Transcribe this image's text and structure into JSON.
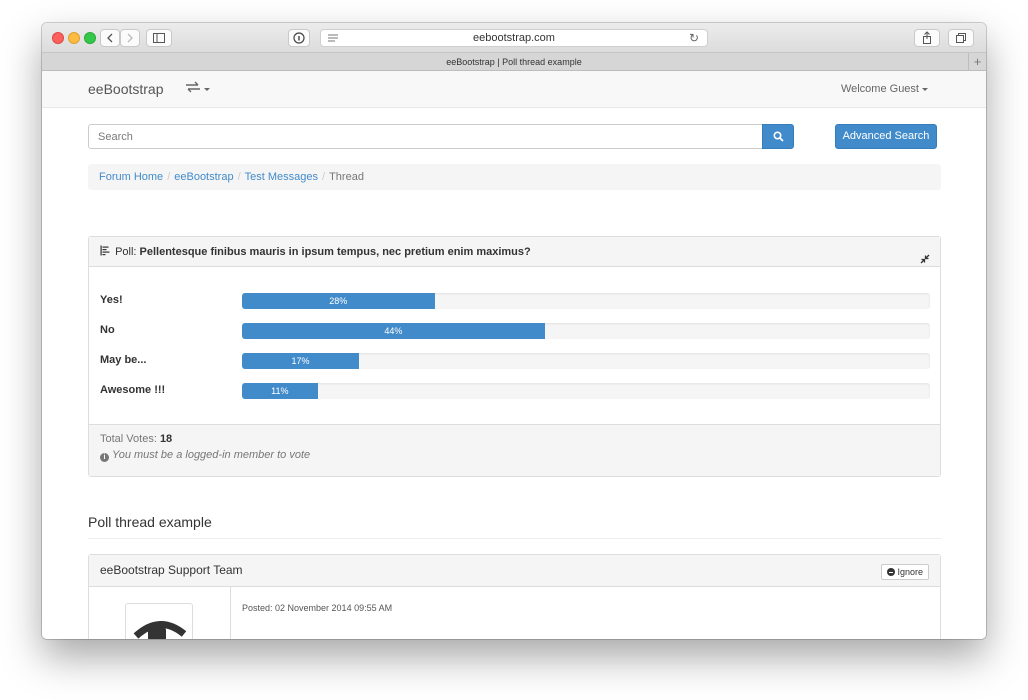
{
  "browser": {
    "url": "eebootstrap.com",
    "tab_title": "eeBootstrap | Poll thread example"
  },
  "navbar": {
    "brand": "eeBootstrap",
    "welcome": "Welcome Guest"
  },
  "search": {
    "placeholder": "Search",
    "advanced_label": "Advanced Search"
  },
  "breadcrumb": {
    "items": [
      "Forum Home",
      "eeBootstrap",
      "Test Messages"
    ],
    "current": "Thread"
  },
  "poll": {
    "prefix": "Poll:",
    "question": "Pellentesque finibus mauris in ipsum tempus, nec pretium enim maximus?",
    "options": [
      {
        "label": "Yes!",
        "percent": 28,
        "percent_text": "28%"
      },
      {
        "label": "No",
        "percent": 44,
        "percent_text": "44%"
      },
      {
        "label": "May be...",
        "percent": 17,
        "percent_text": "17%"
      },
      {
        "label": "Awesome !!!",
        "percent": 11,
        "percent_text": "11%"
      }
    ],
    "total_label": "Total Votes:",
    "total_votes": "18",
    "login_note": "You must be a logged-in member to vote"
  },
  "thread": {
    "title": "Poll thread example"
  },
  "post": {
    "author": "eeBootstrap Support Team",
    "ignore_label": "Ignore",
    "posted": "Posted: 02 November 2014 09:55 AM"
  },
  "colors": {
    "primary": "#428bca",
    "panel_bg": "#f5f5f5",
    "link": "#428bca"
  }
}
